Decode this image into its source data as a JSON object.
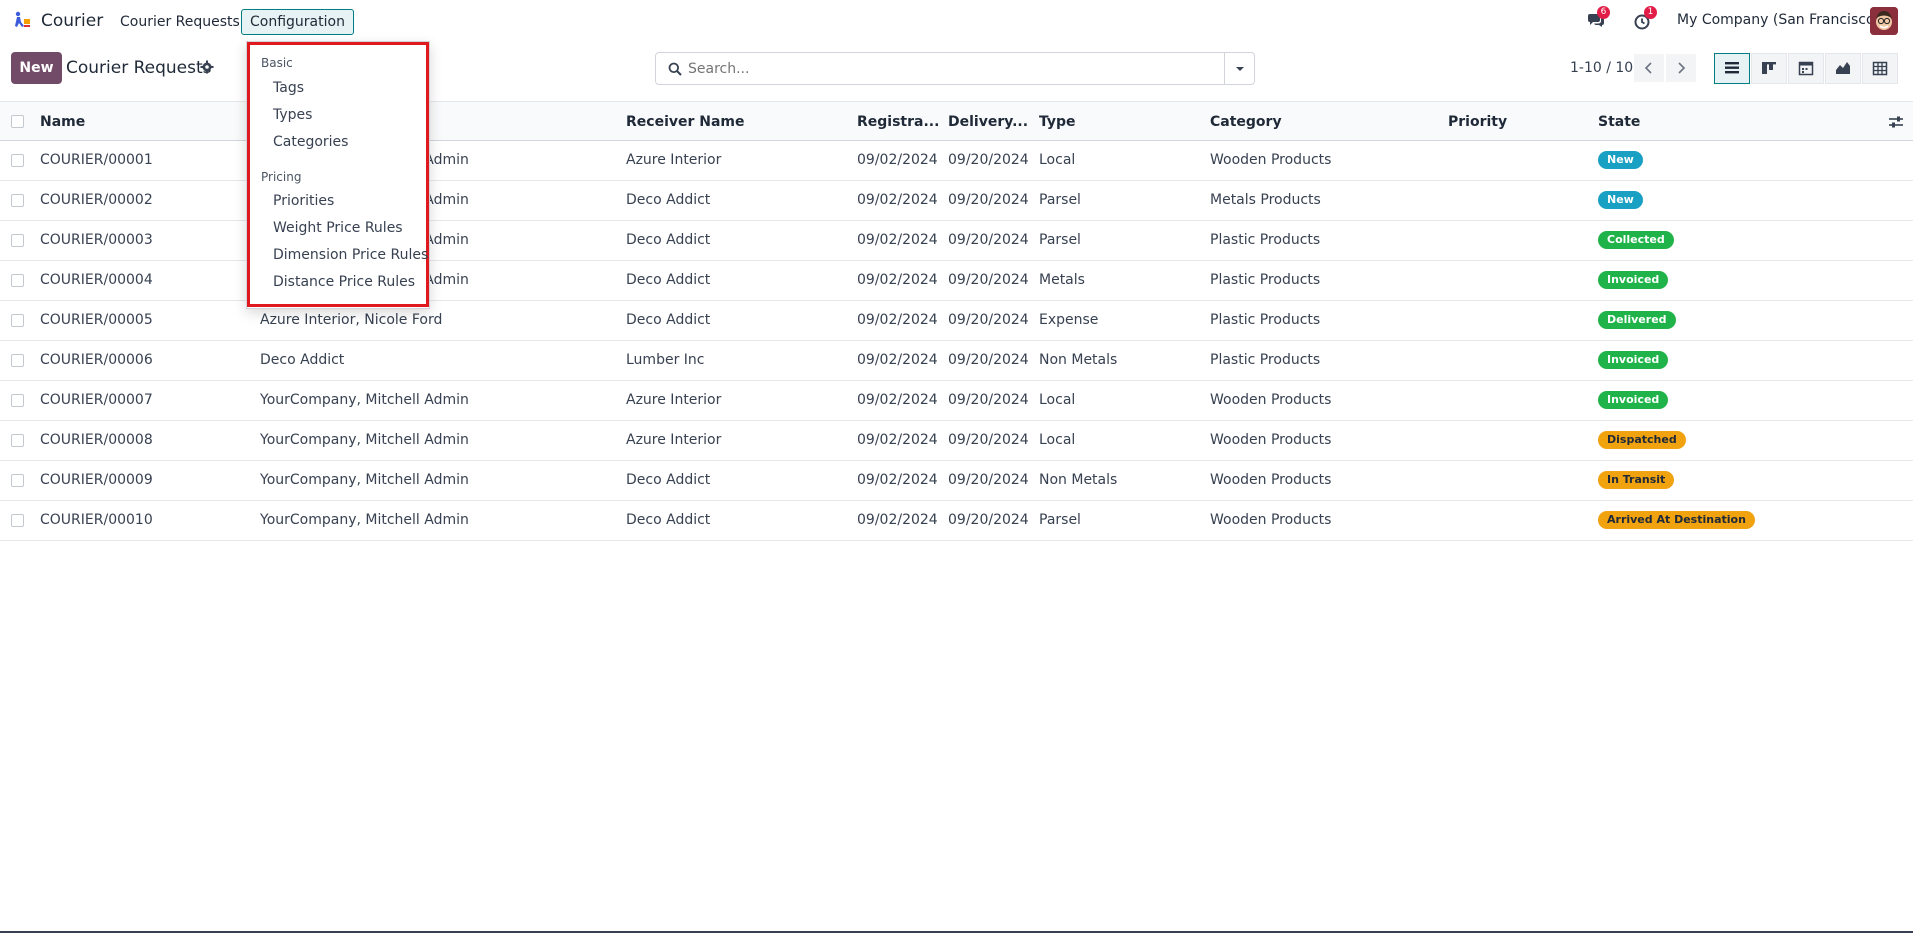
{
  "app": {
    "name": "Courier",
    "logo_icon": "courier-logo-icon"
  },
  "nav": {
    "menus": [
      "Courier Requests",
      "Configuration"
    ],
    "messages_count": "6",
    "activities_count": "1",
    "company": "My Company (San Francisco)"
  },
  "control": {
    "new_label": "New",
    "title": "Courier Requests",
    "search_placeholder": "Search...",
    "pager": "1-10 / 10"
  },
  "table": {
    "headers": [
      "Name",
      "Receiver Name",
      "Registra...",
      "Delivery...",
      "Type",
      "Category",
      "Priority",
      "State"
    ],
    "rows": [
      {
        "name": "COURIER/00001",
        "sender": "YourCompany, Mitchell Admin",
        "receiver": "Azure Interior",
        "reg": "09/02/2024",
        "del": "09/20/2024",
        "type": "Local",
        "category": "Wooden Products",
        "state": "New"
      },
      {
        "name": "COURIER/00002",
        "sender": "YourCompany, Mitchell Admin",
        "receiver": "Deco Addict",
        "reg": "09/02/2024",
        "del": "09/20/2024",
        "type": "Parsel",
        "category": "Metals Products",
        "state": "New"
      },
      {
        "name": "COURIER/00003",
        "sender": "YourCompany, Mitchell Admin",
        "receiver": "Deco Addict",
        "reg": "09/02/2024",
        "del": "09/20/2024",
        "type": "Parsel",
        "category": "Plastic Products",
        "state": "Collected"
      },
      {
        "name": "COURIER/00004",
        "sender": "YourCompany, Mitchell Admin",
        "receiver": "Deco Addict",
        "reg": "09/02/2024",
        "del": "09/20/2024",
        "type": "Metals",
        "category": "Plastic Products",
        "state": "Invoiced"
      },
      {
        "name": "COURIER/00005",
        "sender": "Azure Interior, Nicole Ford",
        "receiver": "Deco Addict",
        "reg": "09/02/2024",
        "del": "09/20/2024",
        "type": "Expense",
        "category": "Plastic Products",
        "state": "Delivered"
      },
      {
        "name": "COURIER/00006",
        "sender": "Deco Addict",
        "receiver": "Lumber Inc",
        "reg": "09/02/2024",
        "del": "09/20/2024",
        "type": "Non Metals",
        "category": "Plastic Products",
        "state": "Invoiced"
      },
      {
        "name": "COURIER/00007",
        "sender": "YourCompany, Mitchell Admin",
        "receiver": "Azure Interior",
        "reg": "09/02/2024",
        "del": "09/20/2024",
        "type": "Local",
        "category": "Wooden Products",
        "state": "Invoiced"
      },
      {
        "name": "COURIER/00008",
        "sender": "YourCompany, Mitchell Admin",
        "receiver": "Azure Interior",
        "reg": "09/02/2024",
        "del": "09/20/2024",
        "type": "Local",
        "category": "Wooden Products",
        "state": "Dispatched"
      },
      {
        "name": "COURIER/00009",
        "sender": "YourCompany, Mitchell Admin",
        "receiver": "Deco Addict",
        "reg": "09/02/2024",
        "del": "09/20/2024",
        "type": "Non Metals",
        "category": "Wooden Products",
        "state": "In Transit"
      },
      {
        "name": "COURIER/00010",
        "sender": "YourCompany, Mitchell Admin",
        "receiver": "Deco Addict",
        "reg": "09/02/2024",
        "del": "09/20/2024",
        "type": "Parsel",
        "category": "Wooden Products",
        "state": "Arrived At Destination"
      }
    ]
  },
  "state_colors": {
    "New": "#1aa0c2",
    "Collected": "#20b34a",
    "Invoiced": "#20b34a",
    "Delivered": "#20b34a",
    "Dispatched": "#f0a20f",
    "In Transit": "#f0a20f",
    "Arrived At Destination": "#f0a20f"
  },
  "dropdown": {
    "basic_header": "Basic",
    "basic_items": [
      "Tags",
      "Types",
      "Categories"
    ],
    "pricing_header": "Pricing",
    "pricing_items": [
      "Priorities",
      "Weight Price Rules",
      "Dimension Price Rules",
      "Distance Price Rules"
    ]
  }
}
